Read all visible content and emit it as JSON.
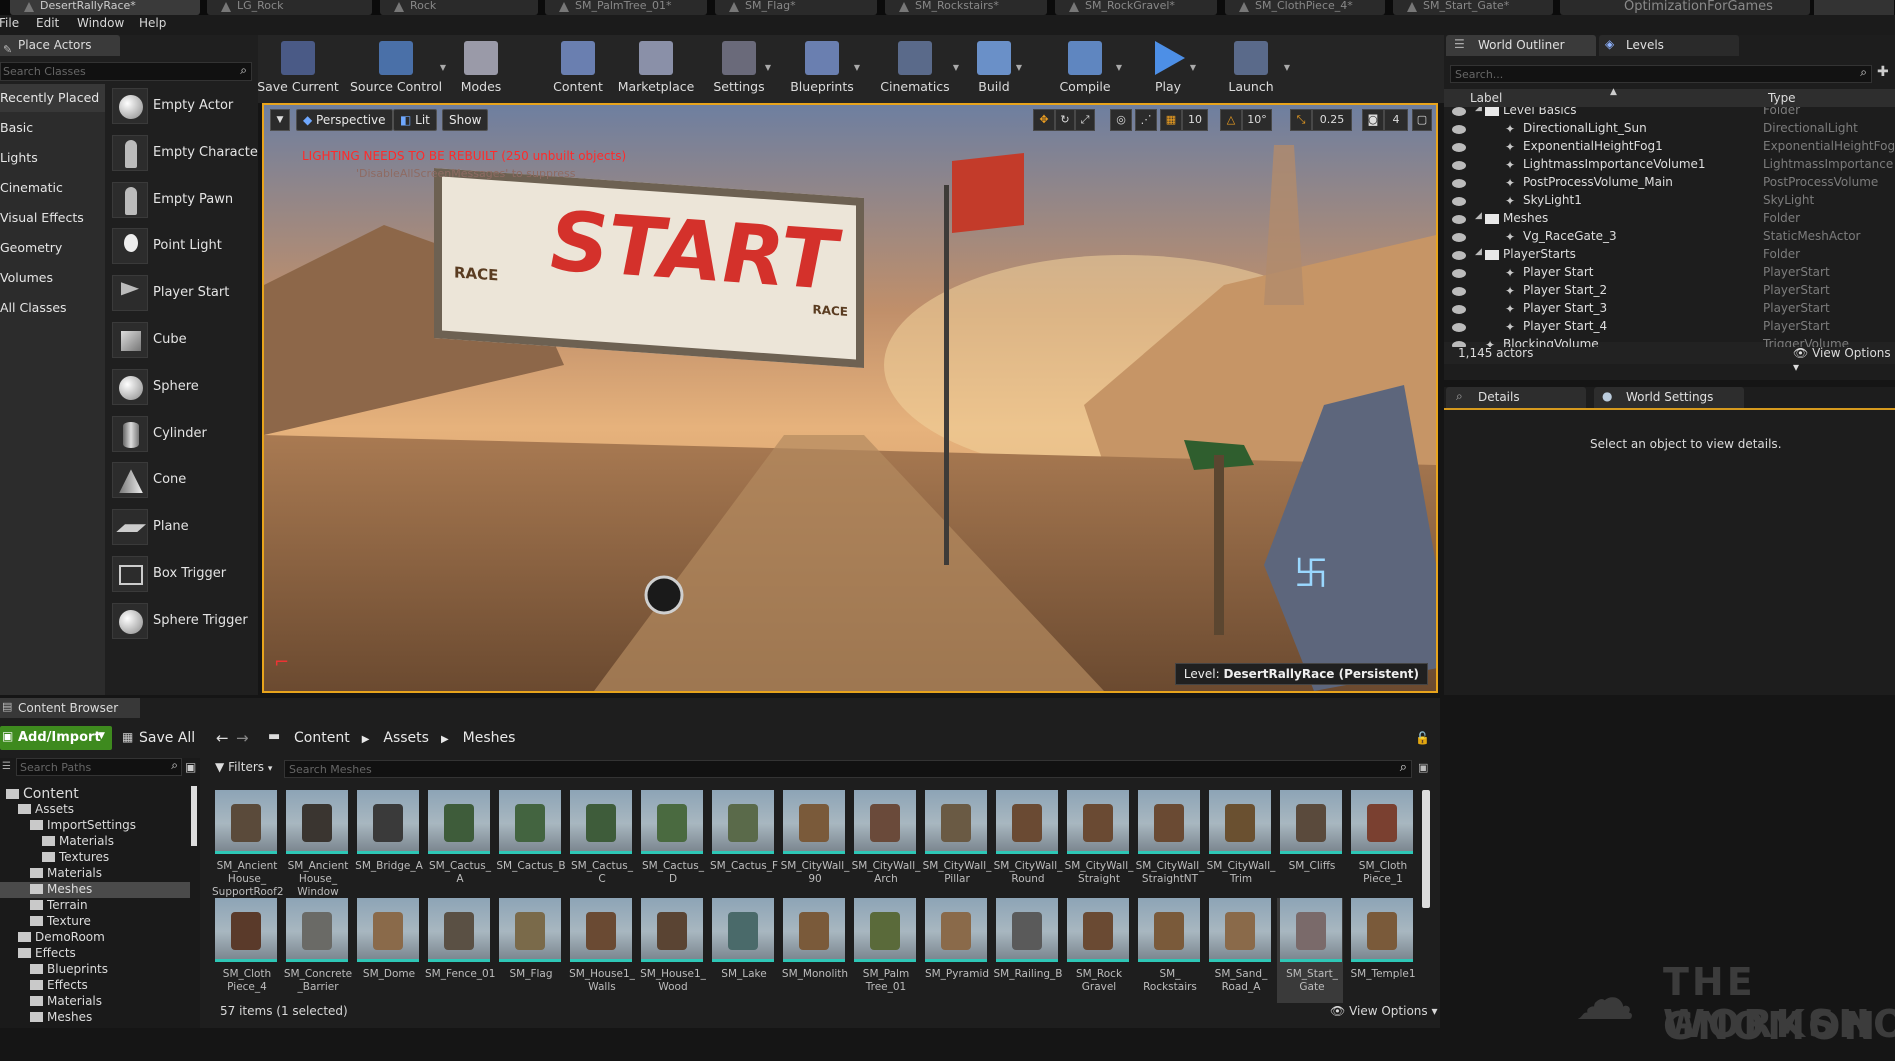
{
  "tabs": [
    "DesertRallyRace*",
    "LG_Rock",
    "Rock",
    "SM_PalmTree_01*",
    "SM_Flag*",
    "SM_Rockstairs*",
    "SM_RockGravel*",
    "SM_ClothPiece_4*",
    "SM_Start_Gate*"
  ],
  "project_title": "OptimizationForGames",
  "menu": [
    "File",
    "Edit",
    "Window",
    "Help"
  ],
  "place_actors": {
    "title": "Place Actors",
    "search_placeholder": "Search Classes",
    "categories": [
      "Recently Placed",
      "Basic",
      "Lights",
      "Cinematic",
      "Visual Effects",
      "Geometry",
      "Volumes",
      "All Classes"
    ],
    "actors": [
      "Empty Actor",
      "Empty Characte",
      "Empty Pawn",
      "Point Light",
      "Player Start",
      "Cube",
      "Sphere",
      "Cylinder",
      "Cone",
      "Plane",
      "Box Trigger",
      "Sphere Trigger"
    ]
  },
  "toolbar": [
    {
      "label": "Save Current",
      "icon": "save-icon"
    },
    {
      "label": "Source Control",
      "icon": "source-control-icon"
    },
    {
      "label": "Modes",
      "icon": "modes-icon"
    },
    {
      "label": "Content",
      "icon": "content-icon"
    },
    {
      "label": "Marketplace",
      "icon": "marketplace-icon"
    },
    {
      "label": "Settings",
      "icon": "settings-icon"
    },
    {
      "label": "Blueprints",
      "icon": "blueprints-icon"
    },
    {
      "label": "Cinematics",
      "icon": "cinematics-icon"
    },
    {
      "label": "Build",
      "icon": "build-icon"
    },
    {
      "label": "Compile",
      "icon": "compile-icon"
    },
    {
      "label": "Play",
      "icon": "play-icon"
    },
    {
      "label": "Launch",
      "icon": "launch-icon"
    }
  ],
  "viewport": {
    "perspective": "Perspective",
    "lit": "Lit",
    "show": "Show",
    "warning": "LIGHTING NEEDS TO BE REBUILT (250 unbuilt objects)",
    "warning_sub": "'DisableAllScreenMessages' to suppress",
    "grid_snap": "10",
    "rot_snap": "10°",
    "scale_snap": "0.25",
    "cam_speed": "4",
    "level_label": "Level:",
    "level_name": "DesertRallyRace (Persistent)",
    "banner_text": "START",
    "banner_small_left": "RACE",
    "banner_small_right": "RACE"
  },
  "outliner": {
    "tabs": [
      "World Outliner",
      "Levels"
    ],
    "search_placeholder": "Search...",
    "col_label": "Label",
    "col_type": "Type",
    "rows": [
      {
        "label": "Level Basics",
        "type": "Folder",
        "depth": 1
      },
      {
        "label": "DirectionalLight_Sun",
        "type": "DirectionalLight",
        "depth": 2
      },
      {
        "label": "ExponentialHeightFog1",
        "type": "ExponentialHeightFog",
        "depth": 2
      },
      {
        "label": "LightmassImportanceVolume1",
        "type": "LightmassImportance",
        "depth": 2
      },
      {
        "label": "PostProcessVolume_Main",
        "type": "PostProcessVolume",
        "depth": 2
      },
      {
        "label": "SkyLight1",
        "type": "SkyLight",
        "depth": 2
      },
      {
        "label": "Meshes",
        "type": "Folder",
        "depth": 1
      },
      {
        "label": "Vg_RaceGate_3",
        "type": "StaticMeshActor",
        "depth": 2
      },
      {
        "label": "PlayerStarts",
        "type": "Folder",
        "depth": 1
      },
      {
        "label": "Player Start",
        "type": "PlayerStart",
        "depth": 2
      },
      {
        "label": "Player Start_2",
        "type": "PlayerStart",
        "depth": 2
      },
      {
        "label": "Player Start_3",
        "type": "PlayerStart",
        "depth": 2
      },
      {
        "label": "Player Start_4",
        "type": "PlayerStart",
        "depth": 2
      },
      {
        "label": "BlockingVolume",
        "type": "TriggerVolume",
        "depth": 1
      }
    ],
    "count": "1,145 actors",
    "view_options": "View Options"
  },
  "details": {
    "tabs": [
      "Details",
      "World Settings"
    ],
    "empty_msg": "Select an object to view details."
  },
  "content_browser": {
    "title": "Content Browser",
    "add_import": "Add/Import",
    "save_all": "Save All",
    "breadcrumbs": [
      "Content",
      "Assets",
      "Meshes"
    ],
    "search_paths": "Search Paths",
    "filters": "Filters",
    "search_assets": "Search Meshes",
    "tree": [
      {
        "label": "Content",
        "depth": 0
      },
      {
        "label": "Assets",
        "depth": 1
      },
      {
        "label": "ImportSettings",
        "depth": 2
      },
      {
        "label": "Materials",
        "depth": 3
      },
      {
        "label": "Textures",
        "depth": 3
      },
      {
        "label": "Materials",
        "depth": 2
      },
      {
        "label": "Meshes",
        "depth": 2
      },
      {
        "label": "Terrain",
        "depth": 2
      },
      {
        "label": "Texture",
        "depth": 2
      },
      {
        "label": "DemoRoom",
        "depth": 1
      },
      {
        "label": "Effects",
        "depth": 1
      },
      {
        "label": "Blueprints",
        "depth": 2
      },
      {
        "label": "Effects",
        "depth": 2
      },
      {
        "label": "Materials",
        "depth": 2
      },
      {
        "label": "Meshes",
        "depth": 2
      }
    ],
    "assets": [
      "SM_Ancient House_ SupportRoof2",
      "SM_Ancient House_ Window",
      "SM_Bridge_A",
      "SM_Cactus_ A",
      "SM_Cactus_B",
      "SM_Cactus_ C",
      "SM_Cactus_ D",
      "SM_Cactus_F",
      "SM_CityWall_ 90",
      "SM_CityWall_ Arch",
      "SM_CityWall_ Pillar",
      "SM_CityWall_ Round",
      "SM_CityWall_ Straight",
      "SM_CityWall_ StraightNT",
      "SM_CityWall_ Trim",
      "SM_Cliffs",
      "SM_Cloth Piece_1",
      "SM_Cloth Piece_4",
      "SM_Concrete _Barrier",
      "SM_Dome",
      "SM_Fence_01",
      "SM_Flag",
      "SM_House1_ Walls",
      "SM_House1_ Wood",
      "SM_Lake",
      "SM_Monolith",
      "SM_Palm Tree_01",
      "SM_Pyramid",
      "SM_Railing_B",
      "SM_Rock Gravel",
      "SM_ Rockstairs",
      "SM_Sand_ Road_A",
      "SM_Start_ Gate",
      "SM_Temple1"
    ],
    "status": "57 items (1 selected)",
    "view_options": "View Options"
  },
  "watermark": {
    "line1": "THE GNOMON",
    "line2": "WORKSHOP"
  }
}
